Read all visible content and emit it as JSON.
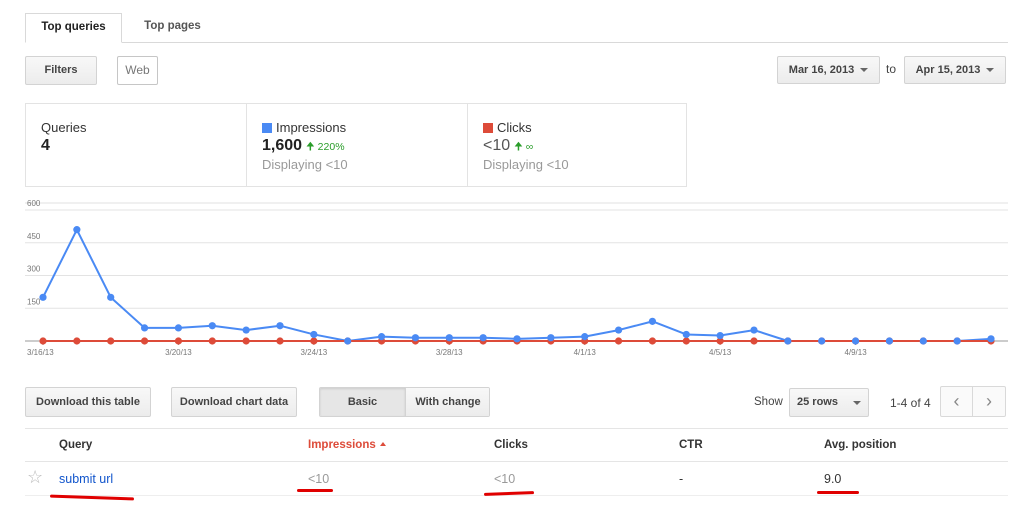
{
  "tabs": [
    {
      "label": "Top queries",
      "active": true
    },
    {
      "label": "Top pages",
      "active": false
    }
  ],
  "filters": {
    "button_label": "Filters",
    "search_type": "Web"
  },
  "date_range": {
    "start": "Mar 16, 2013",
    "separator": "to",
    "end": "Apr 15, 2013"
  },
  "summary": {
    "queries": {
      "label": "Queries",
      "value": "4"
    },
    "impressions": {
      "label": "Impressions",
      "value": "1,600",
      "change": "220%",
      "sub": "Displaying <10",
      "color": "#4a8af4"
    },
    "clicks": {
      "label": "Clicks",
      "value": "<10",
      "change": "∞",
      "sub": "Displaying <10",
      "color": "#dd4b39"
    }
  },
  "chart_data": {
    "type": "line",
    "x": [
      "3/16/13",
      "3/17/13",
      "3/18/13",
      "3/19/13",
      "3/20/13",
      "3/21/13",
      "3/22/13",
      "3/23/13",
      "3/24/13",
      "3/25/13",
      "3/26/13",
      "3/27/13",
      "3/28/13",
      "3/29/13",
      "3/30/13",
      "3/31/13",
      "4/1/13",
      "4/2/13",
      "4/3/13",
      "4/4/13",
      "4/5/13",
      "4/6/13",
      "4/7/13",
      "4/8/13",
      "4/9/13",
      "4/10/13",
      "4/11/13",
      "4/12/13",
      "4/13/13"
    ],
    "x_tick_labels": [
      "3/16/13",
      "3/20/13",
      "3/24/13",
      "3/28/13",
      "4/1/13",
      "4/5/13",
      "4/9/13"
    ],
    "y_ticks": [
      150,
      300,
      450,
      600
    ],
    "ylim": [
      0,
      600
    ],
    "grid": true,
    "series": [
      {
        "name": "Impressions",
        "color": "#4a8af4",
        "values": [
          200,
          510,
          200,
          60,
          60,
          70,
          50,
          70,
          30,
          0,
          20,
          15,
          15,
          15,
          10,
          15,
          20,
          50,
          90,
          30,
          25,
          50,
          0,
          0,
          0,
          0,
          0,
          0,
          10
        ]
      },
      {
        "name": "Clicks",
        "color": "#dd4b39",
        "values": [
          0,
          0,
          0,
          0,
          0,
          0,
          0,
          0,
          0,
          0,
          0,
          0,
          0,
          0,
          0,
          0,
          0,
          0,
          0,
          0,
          0,
          0,
          0,
          0,
          0,
          0,
          0,
          0,
          0
        ]
      }
    ]
  },
  "table_controls": {
    "download_table": "Download this table",
    "download_chart": "Download chart data",
    "mode_basic": "Basic",
    "mode_change": "With change",
    "show_label": "Show",
    "rows_value": "25 rows",
    "range_text": "1-4 of 4",
    "prev": "‹",
    "next": "›"
  },
  "table": {
    "headers": {
      "query": "Query",
      "impressions": "Impressions",
      "clicks": "Clicks",
      "ctr": "CTR",
      "avg_position": "Avg. position"
    },
    "rows": [
      {
        "star": "☆",
        "query": "submit url",
        "impressions": "<10",
        "clicks": "<10",
        "ctr": "-",
        "avg_position": "9.0"
      }
    ]
  }
}
